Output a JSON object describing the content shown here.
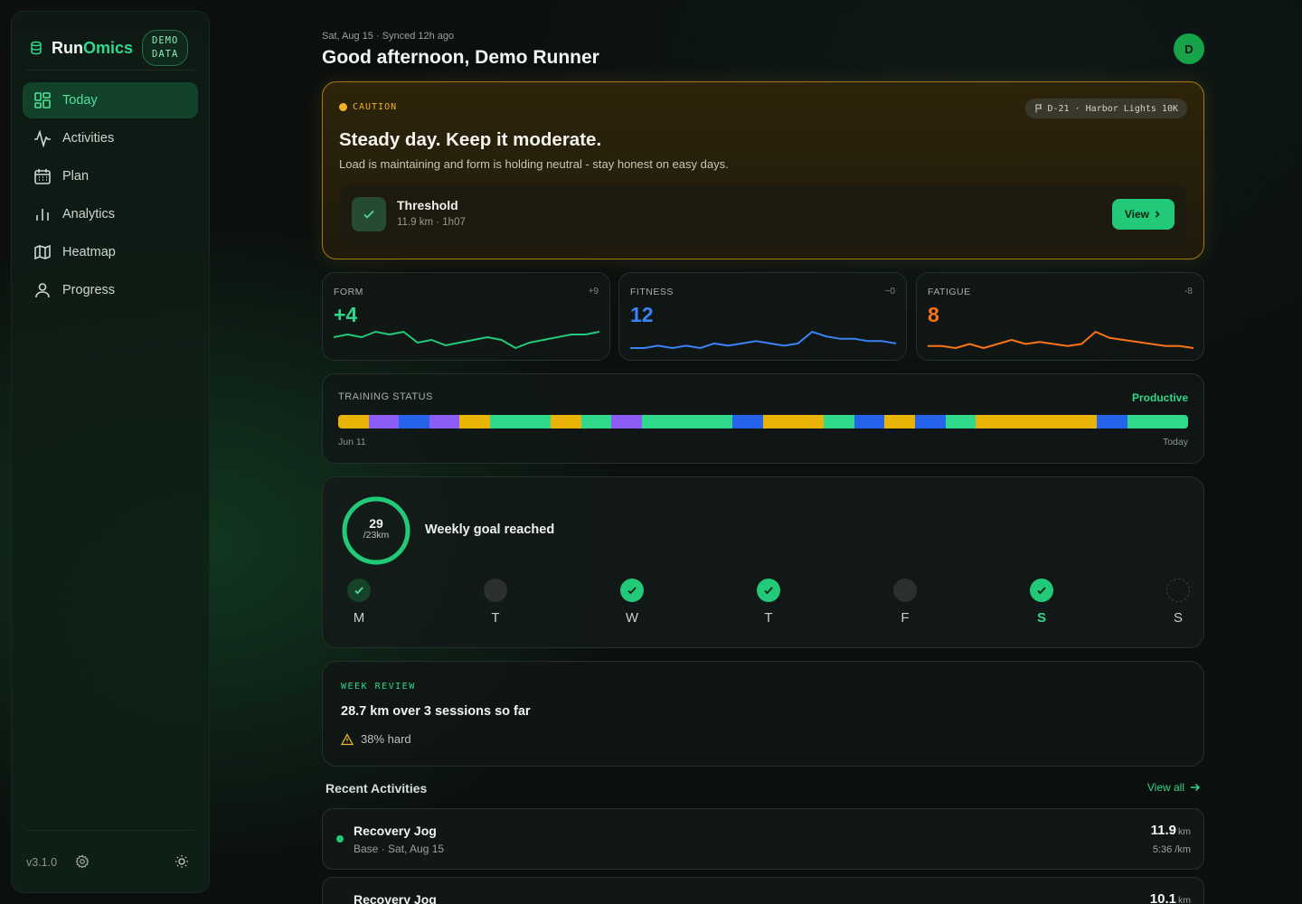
{
  "brand": {
    "name_first": "Run",
    "name_second": "Omics",
    "badge_line1": "DEMO",
    "badge_line2": "DATA"
  },
  "nav": [
    {
      "label": "Today",
      "icon": "grid-icon",
      "active": true
    },
    {
      "label": "Activities",
      "icon": "pulse-icon",
      "active": false
    },
    {
      "label": "Plan",
      "icon": "calendar-icon",
      "active": false
    },
    {
      "label": "Analytics",
      "icon": "bar-chart-icon",
      "active": false
    },
    {
      "label": "Heatmap",
      "icon": "map-icon",
      "active": false
    },
    {
      "label": "Progress",
      "icon": "user-icon",
      "active": false
    }
  ],
  "footer": {
    "version": "v3.1.0"
  },
  "header": {
    "date_line": "Sat, Aug 15 · Synced 12h ago",
    "greeting": "Good afternoon, Demo Runner",
    "avatar_initial": "D"
  },
  "caution": {
    "tag": "CAUTION",
    "race_chip": "D-21 · Harbor Lights 10K",
    "title": "Steady day. Keep it moderate.",
    "subtitle": "Load is maintaining and form is holding neutral - stay honest on easy days.",
    "workout_title": "Threshold",
    "workout_meta": "11.9 km · 1h07",
    "view_label": "View"
  },
  "metrics": [
    {
      "label": "FORM",
      "value": "+4",
      "delta": "+9",
      "color": "#22c979",
      "series": [
        5,
        6,
        5,
        7,
        6,
        7,
        3,
        4,
        2,
        3,
        4,
        5,
        4,
        1,
        3,
        4,
        5,
        6,
        6,
        7
      ]
    },
    {
      "label": "FITNESS",
      "value": "12",
      "delta": "~0",
      "color": "#3b82f6",
      "series": [
        2,
        2,
        3,
        2,
        3,
        2,
        4,
        3,
        4,
        5,
        4,
        3,
        4,
        9,
        7,
        6,
        6,
        5,
        5,
        4
      ]
    },
    {
      "label": "FATIGUE",
      "value": "8",
      "delta": "-8",
      "color": "#f97316",
      "series": [
        3,
        3,
        2,
        4,
        2,
        4,
        6,
        4,
        5,
        4,
        3,
        4,
        10,
        7,
        6,
        5,
        4,
        3,
        3,
        2
      ]
    }
  ],
  "training_status": {
    "label": "TRAINING STATUS",
    "status": "Productive",
    "start_label": "Jun 11",
    "end_label": "Today",
    "segments": [
      {
        "color": "#eab308",
        "weight": 1
      },
      {
        "color": "#8b5cf6",
        "weight": 1
      },
      {
        "color": "#2563eb",
        "weight": 1
      },
      {
        "color": "#8b5cf6",
        "weight": 1
      },
      {
        "color": "#eab308",
        "weight": 1
      },
      {
        "color": "#2fd88a",
        "weight": 2
      },
      {
        "color": "#eab308",
        "weight": 1
      },
      {
        "color": "#2fd88a",
        "weight": 1
      },
      {
        "color": "#8b5cf6",
        "weight": 1
      },
      {
        "color": "#2fd88a",
        "weight": 3
      },
      {
        "color": "#2563eb",
        "weight": 1
      },
      {
        "color": "#eab308",
        "weight": 2
      },
      {
        "color": "#2fd88a",
        "weight": 1
      },
      {
        "color": "#2563eb",
        "weight": 1
      },
      {
        "color": "#eab308",
        "weight": 1
      },
      {
        "color": "#2563eb",
        "weight": 1
      },
      {
        "color": "#2fd88a",
        "weight": 1
      },
      {
        "color": "#eab308",
        "weight": 4
      },
      {
        "color": "#2563eb",
        "weight": 1
      },
      {
        "color": "#2fd88a",
        "weight": 2
      }
    ]
  },
  "weekly": {
    "distance": "29",
    "goal": "/23km",
    "progress": 1.0,
    "message": "Weekly goal reached",
    "days": [
      {
        "letter": "M",
        "state": "dim"
      },
      {
        "letter": "T",
        "state": "rest"
      },
      {
        "letter": "W",
        "state": "done"
      },
      {
        "letter": "T",
        "state": "done"
      },
      {
        "letter": "F",
        "state": "rest"
      },
      {
        "letter": "S",
        "state": "done",
        "today": true
      },
      {
        "letter": "S",
        "state": "future"
      }
    ]
  },
  "review": {
    "tag": "WEEK REVIEW",
    "title": "28.7 km over 3 sessions so far",
    "hard": "38% hard"
  },
  "recent": {
    "title": "Recent Activities",
    "view_all": "View all",
    "items": [
      {
        "name": "Recovery Jog",
        "meta": "Base · Sat, Aug 15",
        "distance": "11.9",
        "unit": "km",
        "pace": "5:36 /km"
      },
      {
        "name": "Recovery Jog",
        "meta": "",
        "distance": "10.1",
        "unit": "km",
        "pace": ""
      }
    ]
  }
}
